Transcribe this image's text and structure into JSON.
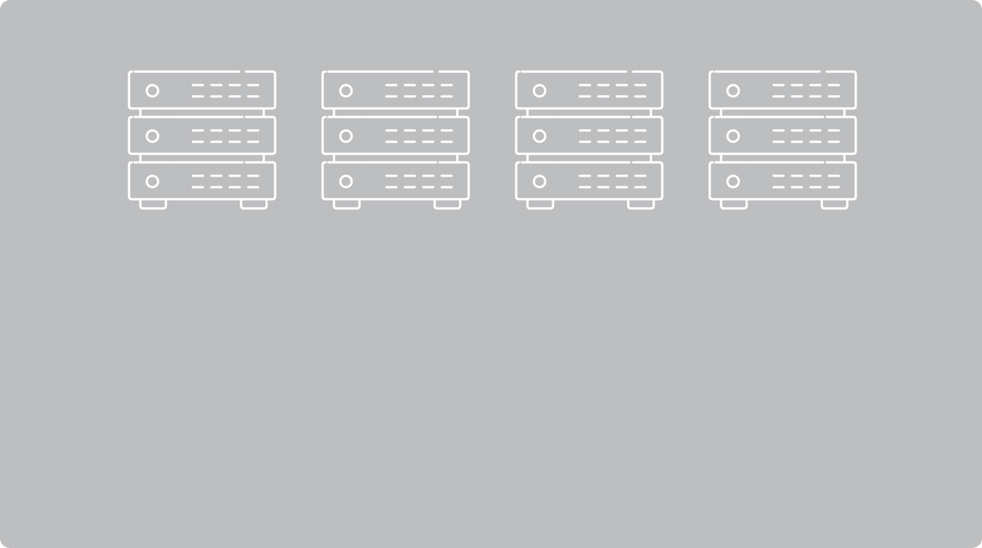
{
  "colors": {
    "background": "#bdbec0",
    "icon_stroke": "#ffffff",
    "page": "#ffffff"
  },
  "server_stacks": [
    {
      "icon": "server-rack-icon",
      "units": 3
    },
    {
      "icon": "server-rack-icon",
      "units": 3
    },
    {
      "icon": "server-rack-icon",
      "units": 3
    },
    {
      "icon": "server-rack-icon",
      "units": 3
    }
  ]
}
